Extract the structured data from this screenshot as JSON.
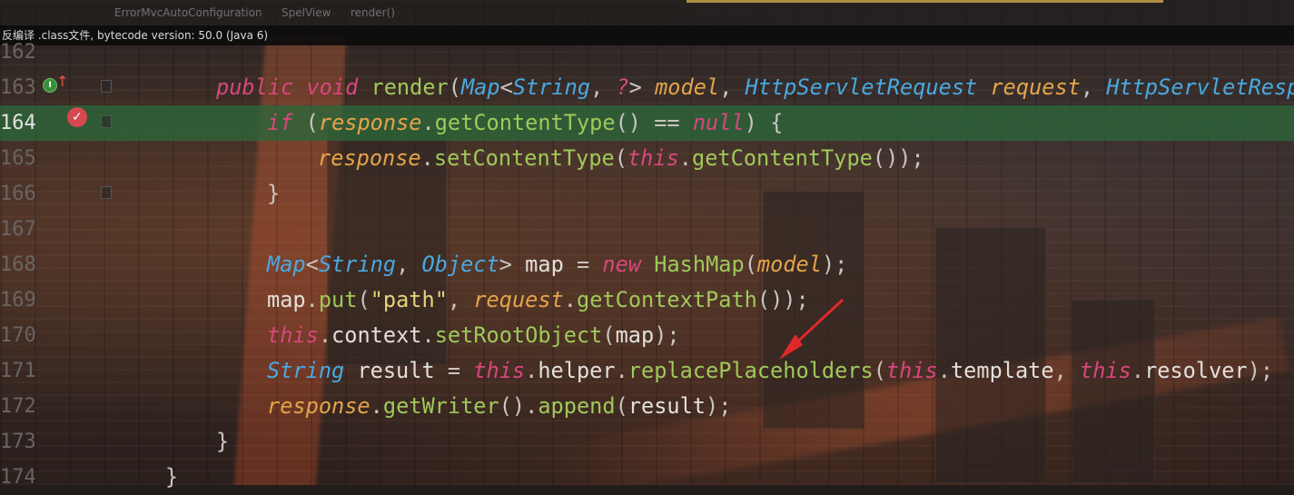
{
  "tabs": {
    "items": [
      {
        "label": "ErrorMvcAutoConfiguration"
      },
      {
        "label": "SpelView"
      },
      {
        "label": "render()"
      }
    ]
  },
  "notice": {
    "text": "反编译 .class文件, bytecode version: 50.0 (Java 6)"
  },
  "colors": {
    "keyword": "#d8477e",
    "type": "#4aa8e0",
    "parameter": "#e5a44a",
    "method": "#9fc95a",
    "string": "#e8d27a",
    "current_line": "#2c663a",
    "annotation_arrow": "#e0282a"
  },
  "editor": {
    "current_line": 164,
    "lines": [
      {
        "num": "162",
        "tokens": []
      },
      {
        "num": "163",
        "tokens": [
          [
            "kw",
            "public"
          ],
          [
            "plain",
            " "
          ],
          [
            "kw",
            "void"
          ],
          [
            "plain",
            " "
          ],
          [
            "mth",
            "render"
          ],
          [
            "punc",
            "("
          ],
          [
            "ty",
            "Map"
          ],
          [
            "punc",
            "<"
          ],
          [
            "ty",
            "String"
          ],
          [
            "punc",
            ", "
          ],
          [
            "kw",
            "?"
          ],
          [
            "punc",
            "> "
          ],
          [
            "par",
            "model"
          ],
          [
            "punc",
            ", "
          ],
          [
            "ty",
            "HttpServletRequest"
          ],
          [
            "plain",
            " "
          ],
          [
            "par",
            "request"
          ],
          [
            "punc",
            ", "
          ],
          [
            "ty",
            "HttpServletRespo"
          ]
        ]
      },
      {
        "num": "164",
        "tokens": [
          [
            "kw",
            "if"
          ],
          [
            "plain",
            " "
          ],
          [
            "punc",
            "("
          ],
          [
            "par",
            "response"
          ],
          [
            "punc",
            "."
          ],
          [
            "mth",
            "getContentType"
          ],
          [
            "punc",
            "() == "
          ],
          [
            "kw",
            "null"
          ],
          [
            "punc",
            ") {"
          ]
        ]
      },
      {
        "num": "165",
        "tokens": [
          [
            "par",
            "response"
          ],
          [
            "punc",
            "."
          ],
          [
            "mth",
            "setContentType"
          ],
          [
            "punc",
            "("
          ],
          [
            "kw",
            "this"
          ],
          [
            "punc",
            "."
          ],
          [
            "mth",
            "getContentType"
          ],
          [
            "punc",
            "());"
          ]
        ]
      },
      {
        "num": "166",
        "tokens": [
          [
            "punc",
            "}"
          ]
        ]
      },
      {
        "num": "167",
        "tokens": []
      },
      {
        "num": "168",
        "tokens": [
          [
            "ty",
            "Map"
          ],
          [
            "punc",
            "<"
          ],
          [
            "ty",
            "String"
          ],
          [
            "punc",
            ", "
          ],
          [
            "ty",
            "Object"
          ],
          [
            "punc",
            "> "
          ],
          [
            "plain",
            "map"
          ],
          [
            "punc",
            " = "
          ],
          [
            "kw",
            "new"
          ],
          [
            "plain",
            " "
          ],
          [
            "mth",
            "HashMap"
          ],
          [
            "punc",
            "("
          ],
          [
            "par",
            "model"
          ],
          [
            "punc",
            ");"
          ]
        ]
      },
      {
        "num": "169",
        "tokens": [
          [
            "plain",
            "map"
          ],
          [
            "punc",
            "."
          ],
          [
            "mth",
            "put"
          ],
          [
            "punc",
            "("
          ],
          [
            "str",
            "\"path\""
          ],
          [
            "punc",
            ", "
          ],
          [
            "par",
            "request"
          ],
          [
            "punc",
            "."
          ],
          [
            "mth",
            "getContextPath"
          ],
          [
            "punc",
            "());"
          ]
        ]
      },
      {
        "num": "170",
        "tokens": [
          [
            "kw",
            "this"
          ],
          [
            "punc",
            "."
          ],
          [
            "plain",
            "context"
          ],
          [
            "punc",
            "."
          ],
          [
            "mth",
            "setRootObject"
          ],
          [
            "punc",
            "("
          ],
          [
            "plain",
            "map"
          ],
          [
            "punc",
            ");"
          ]
        ]
      },
      {
        "num": "171",
        "tokens": [
          [
            "ty",
            "String"
          ],
          [
            "plain",
            " result"
          ],
          [
            "punc",
            " = "
          ],
          [
            "kw",
            "this"
          ],
          [
            "punc",
            "."
          ],
          [
            "plain",
            "helper"
          ],
          [
            "punc",
            "."
          ],
          [
            "mth",
            "replacePlaceholders"
          ],
          [
            "punc",
            "("
          ],
          [
            "kw",
            "this"
          ],
          [
            "punc",
            "."
          ],
          [
            "plain",
            "template"
          ],
          [
            "punc",
            ", "
          ],
          [
            "kw",
            "this"
          ],
          [
            "punc",
            "."
          ],
          [
            "plain",
            "resolver"
          ],
          [
            "punc",
            ");"
          ]
        ]
      },
      {
        "num": "172",
        "tokens": [
          [
            "par",
            "response"
          ],
          [
            "punc",
            "."
          ],
          [
            "mth",
            "getWriter"
          ],
          [
            "punc",
            "()."
          ],
          [
            "mth",
            "append"
          ],
          [
            "punc",
            "("
          ],
          [
            "plain",
            "result"
          ],
          [
            "punc",
            ");"
          ]
        ]
      },
      {
        "num": "173",
        "tokens": [
          [
            "punc",
            "}"
          ]
        ]
      },
      {
        "num": "174",
        "tokens": [
          [
            "punc",
            "}"
          ]
        ]
      }
    ]
  },
  "gutter": {
    "implements_icon": "implements-method-icon",
    "implements_letter": "I",
    "override_arrow": "up-arrow-icon",
    "override_glyph": "↑",
    "breakpoint_icon": "breakpoint-icon",
    "breakpoint_glyph": "✓"
  }
}
